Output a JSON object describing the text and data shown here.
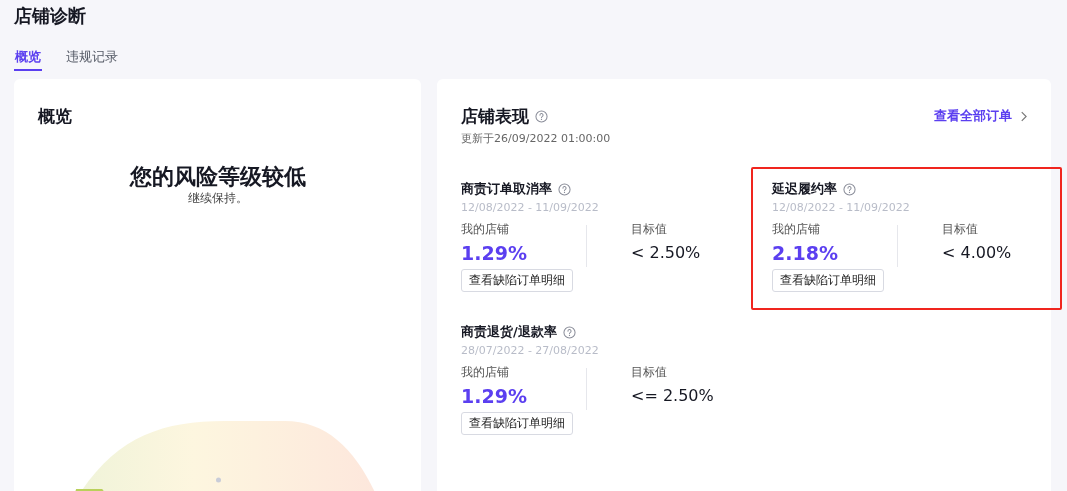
{
  "page_title": "店铺诊断",
  "tabs": [
    {
      "label": "概览",
      "selected": true
    },
    {
      "label": "违规记录",
      "selected": false
    }
  ],
  "overview_card": {
    "title": "概览",
    "risk_heading": "您的风险等级较低",
    "risk_note": "继续保持。"
  },
  "performance_card": {
    "title": "店铺表现",
    "updated": "更新于26/09/2022 01:00:00",
    "view_all_link": "查看全部订单",
    "metrics": [
      {
        "title": "商责订单取消率",
        "period": "12/08/2022 - 11/09/2022",
        "my_store_label": "我的店铺",
        "my_store_value": "1.29%",
        "target_label": "目标值",
        "target_value": "< 2.50%",
        "button": "查看缺陷订单明细",
        "highlighted": false
      },
      {
        "title": "延迟履约率",
        "period": "12/08/2022 - 11/09/2022",
        "my_store_label": "我的店铺",
        "my_store_value": "2.18%",
        "target_label": "目标值",
        "target_value": "< 4.00%",
        "button": "查看缺陷订单明细",
        "highlighted": true
      },
      {
        "title": "商责退货/退款率",
        "period": "28/07/2022 - 27/08/2022",
        "my_store_label": "我的店铺",
        "my_store_value": "1.29%",
        "target_label": "目标值",
        "target_value": "<= 2.50%",
        "button": "查看缺陷订单明细",
        "highlighted": false
      }
    ]
  }
}
